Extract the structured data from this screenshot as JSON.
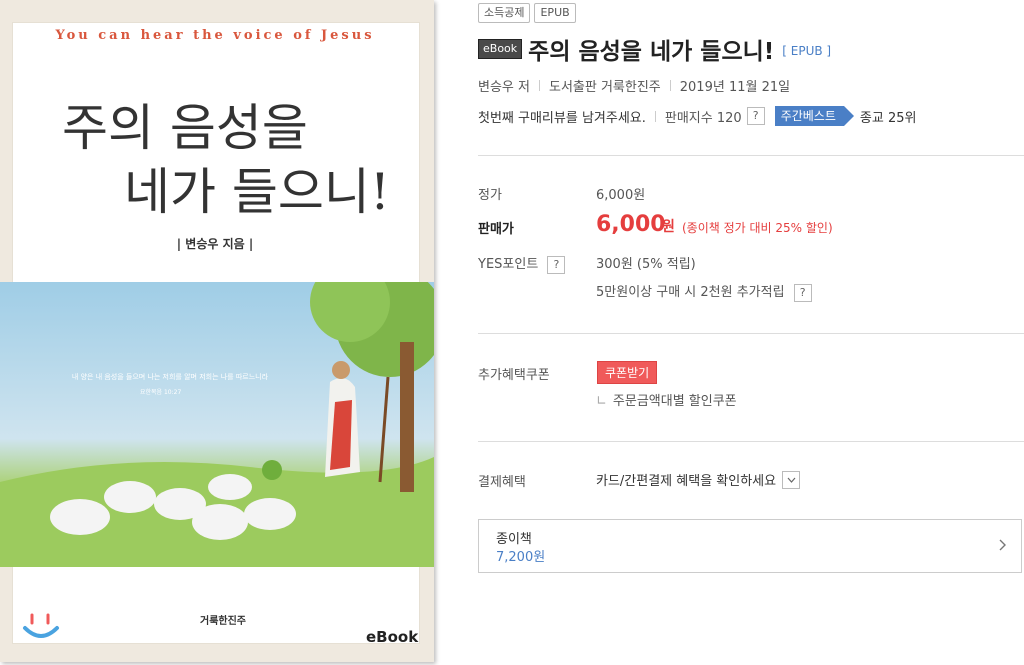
{
  "cover": {
    "english_line": "You can hear the voice of Jesus",
    "title_line1": "주의 음성을",
    "title_line2": "네가 들으니!",
    "author": "| 변승우 지음 |",
    "verse": "내 양은 내 음성을 들으며 나는 저희를 알며 저희는 나를 따르느니라",
    "verse_ref": "요한복음 10:27",
    "publisher_logo": "거룩한진주",
    "ebook_mark": "eBook"
  },
  "badges": [
    "소득공제",
    "EPUB"
  ],
  "product": {
    "ebook_tag": "eBook",
    "title": "주의 음성을 네가 들으니!",
    "format": "[ EPUB ]",
    "author": "변승우 저",
    "publisher": "도서출판 거룩한진주",
    "date": "2019년 11월 21일",
    "review_prompt": "첫번째 구매리뷰를 남겨주세요.",
    "sales_index": "판매지수 120",
    "help_glyph": "?",
    "best_badge": "주간베스트",
    "rank": "종교 25위"
  },
  "pricing": {
    "list_label": "정가",
    "list_price": "6,000원",
    "sale_label": "판매가",
    "sale_price": "6,000",
    "sale_unit": "원",
    "sale_discount": "(종이책 정가 대비 25% 할인)",
    "points_label": "YES포인트",
    "points_value": "300원 (5% 적립)",
    "points_extra": "5만원이상 구매 시 2천원 추가적립"
  },
  "coupon": {
    "label": "추가혜택쿠폰",
    "button": "쿠폰받기",
    "sub_item": "주문금액대별 할인쿠폰"
  },
  "payment": {
    "label": "결제혜택",
    "select": "카드/간편결제 혜택을 확인하세요"
  },
  "paper_book": {
    "label": "종이책",
    "price": "7,200원"
  },
  "colors": {
    "accent_blue": "#4a7fc6",
    "sale_red": "#e53e3e",
    "coupon_red": "#f05a5a"
  }
}
